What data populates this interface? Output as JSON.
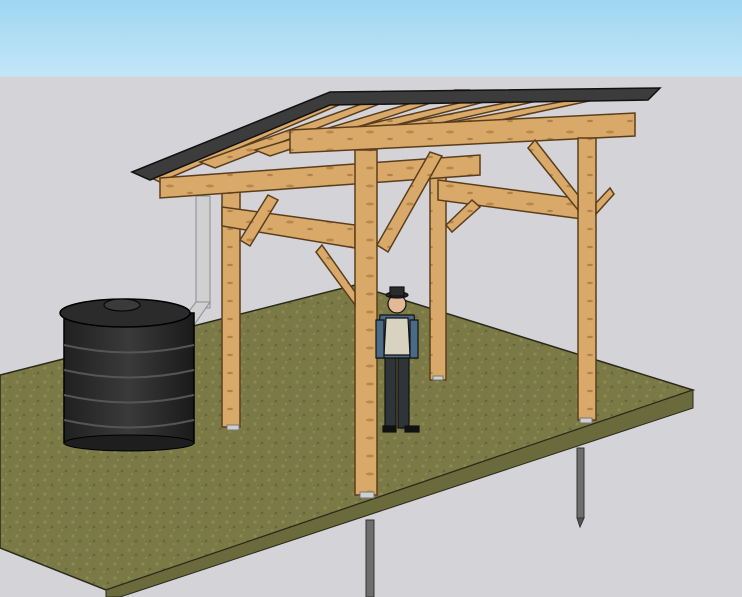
{
  "scene": {
    "sky_color": "#a9dbf3",
    "background_color": "#d4d4d8",
    "ground_color": "#7b7a46",
    "timber_color": "#d9a96a",
    "roof_color": "#3c3c3c",
    "tank_color": "#2f2f2f",
    "downpipe_color": "#d0d0d0"
  }
}
